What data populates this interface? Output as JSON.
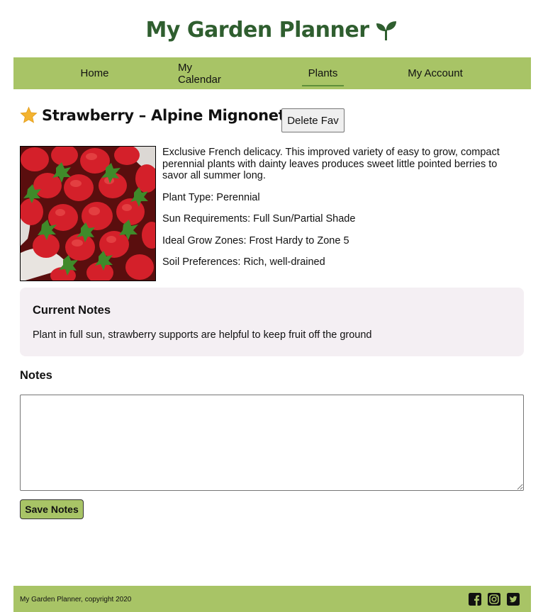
{
  "header": {
    "title": "My Garden Planner",
    "logo_icon": "sprout-icon",
    "brand_color": "#2f5e2f"
  },
  "nav": {
    "items": [
      {
        "label": "Home"
      },
      {
        "label": "My Calendar"
      },
      {
        "label": "Plants",
        "active": true
      },
      {
        "label": "My Account"
      }
    ],
    "background": "#a8c466"
  },
  "plant": {
    "favorite_icon": "star-icon",
    "name": "Strawberry – Alpine Mignonette",
    "delete_fav_label": "Delete Fav",
    "photo_icon": "strawberry-photo",
    "description": "Exclusive French delicacy. This improved variety of easy to grow, compact perennial plants with dainty leaves produces sweet little pointed berries to savor all summer long.",
    "plant_type": "Plant Type: Perennial",
    "sun_requirements": "Sun Requirements: Full Sun/Partial Shade",
    "grow_zones": "Ideal Grow Zones: Frost Hardy to Zone 5",
    "soil_preferences": "Soil Preferences: Rich, well-drained"
  },
  "current_notes": {
    "heading": "Current Notes",
    "text": "Plant in full sun, strawberry supports are helpful to keep fruit off the ground"
  },
  "notes_form": {
    "heading": "Notes",
    "value": "",
    "save_label": "Save Notes"
  },
  "footer": {
    "copyright": "My Garden Planner, copyright 2020",
    "social_icons": [
      "facebook-icon",
      "instagram-icon",
      "twitter-icon"
    ]
  }
}
